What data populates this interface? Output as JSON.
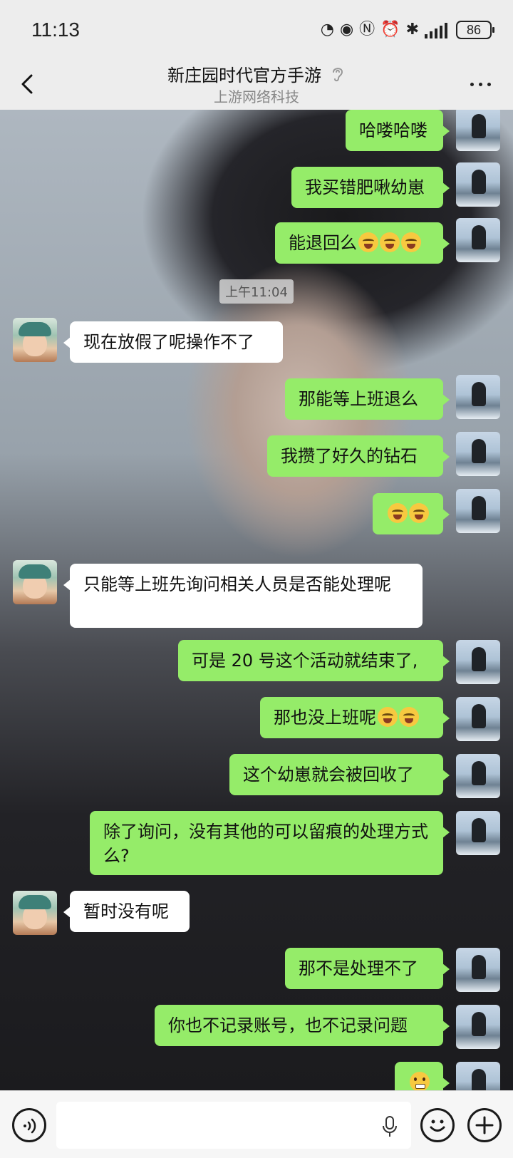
{
  "status_bar": {
    "time": "11:13",
    "battery": "86"
  },
  "header": {
    "title": "新庄园时代官方手游",
    "subtitle": "上游网络科技"
  },
  "messages": [
    {
      "side": "me",
      "text": "哈喽哈喽",
      "emoji_count": 0
    },
    {
      "side": "me",
      "text": "我买错肥啾幼崽",
      "emoji_count": 0
    },
    {
      "side": "me",
      "text": "能退回么",
      "emoji_count": 3
    },
    {
      "side": "timestamp",
      "text": "上午11:04"
    },
    {
      "side": "them",
      "text": "现在放假了呢操作不了"
    },
    {
      "side": "me",
      "text": "那能等上班退么",
      "emoji_count": 0
    },
    {
      "side": "me",
      "text": "我攒了好久的钻石",
      "emoji_count": 0
    },
    {
      "side": "me",
      "text": "",
      "emoji_count": 2
    },
    {
      "side": "them",
      "text": "只能等上班先询问相关人员是否能处理呢"
    },
    {
      "side": "me",
      "text": "可是 20 号这个活动就结束了,",
      "emoji_count": 0
    },
    {
      "side": "me",
      "text": "那也没上班呢",
      "emoji_count": 2
    },
    {
      "side": "me",
      "text": "这个幼崽就会被回收了",
      "emoji_count": 0
    },
    {
      "side": "me",
      "text": "除了询问，没有其他的可以留痕的处理方式么?",
      "emoji_count": 0
    },
    {
      "side": "them",
      "text": "暂时没有呢"
    },
    {
      "side": "me",
      "text": "那不是处理不了",
      "emoji_count": 0
    },
    {
      "side": "me",
      "text": "你也不记录账号，也不记录问题",
      "emoji_count": 0
    },
    {
      "side": "me",
      "text": "",
      "emoji_count": 1,
      "emoji_type": "grimace"
    }
  ],
  "input": {
    "placeholder": ""
  },
  "icons": {
    "back": "chevron-left-icon",
    "ear": "ear-icon",
    "more": "more-dots-icon",
    "voice": "voice-icon",
    "mic": "mic-icon",
    "emoji": "emoji-icon",
    "plus": "plus-icon"
  }
}
